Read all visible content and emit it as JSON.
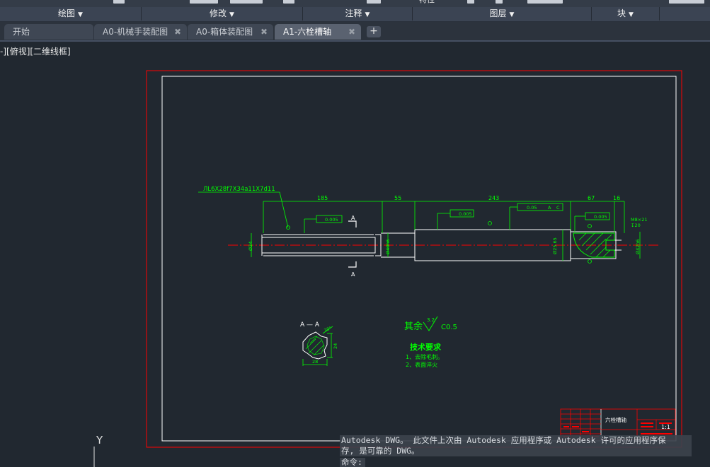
{
  "ribbon": {
    "top_fragments": [
      "特性"
    ],
    "panels": [
      {
        "label": "绘图"
      },
      {
        "label": "修改"
      },
      {
        "label": "注释"
      },
      {
        "label": "图层"
      },
      {
        "label": "块"
      }
    ]
  },
  "tabs": [
    {
      "label": "开始"
    },
    {
      "label": "A0-机械手装配图"
    },
    {
      "label": "A0-箱体装配图"
    },
    {
      "label": "A1-六栓槽轴"
    }
  ],
  "viewport": {
    "label": "-][俯视][二维线框]"
  },
  "drawing": {
    "spline_callout": "ЛL6X28f7X34a11X7d11",
    "dim_185": "185",
    "dim_55": "55",
    "dim_243": "243",
    "dim_67": "67",
    "dim_16": "16",
    "tol_1": "0.005",
    "tol_2": "0.005",
    "tol_3": "0.05",
    "tol_3_a": "A",
    "tol_3_c": "C",
    "tol_4": "0.005",
    "section_mark": "A",
    "diam_left": "Ø24",
    "diam_mid": "Ø40h6",
    "diam_main": "Ø25.65",
    "diam_right": "Ø42h6",
    "thread": "M8×21",
    "thread_depth": "↧20",
    "section_title": "A — A",
    "section_dim_w": "28",
    "section_dim_h": "24",
    "section_label": "30°",
    "rough_prefix": "其余",
    "rough_value": "3.2",
    "chamfer": "C0.5",
    "tech_title": "技术要求",
    "tech_items": [
      "1、去除毛刺。",
      "2、表面淬火"
    ],
    "title_block_name": "六栓槽轴",
    "title_block_scale": "1:1"
  },
  "command": {
    "message_line1": "Autodesk DWG。  此文件上次由 Autodesk 应用程序或 Autodesk 许可的应用程序保",
    "message_line2": "存, 是可靠的 DWG。",
    "prompt": "命令:"
  },
  "ucs": {
    "y_label": "Y"
  },
  "colors": {
    "background": "#212830",
    "drawing_green": "#00ff00",
    "border_red": "#ff0000",
    "frame_white": "#ffffff",
    "centerline_red": "#ff0000"
  }
}
